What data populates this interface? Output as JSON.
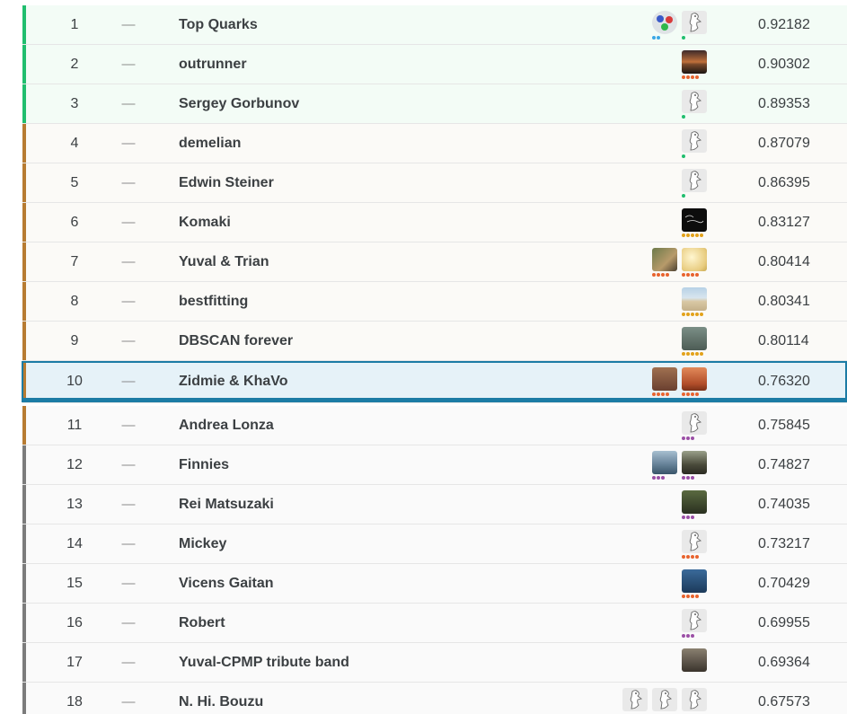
{
  "leaderboard": {
    "rows": [
      {
        "rank": "1",
        "delta": "—",
        "team": "Top Quarks",
        "score": "0.92182",
        "band": "green",
        "style": "gold-top",
        "avatars": [
          {
            "icon": "quark-logo-icon",
            "img": "quark",
            "dots": [
              "#3aa8e6",
              "#3aa8e6"
            ]
          },
          {
            "icon": "goose-avatar-icon",
            "img": "goose",
            "dots": [
              "#20be6e"
            ]
          }
        ]
      },
      {
        "rank": "2",
        "delta": "—",
        "team": "outrunner",
        "score": "0.90302",
        "band": "green",
        "style": "gold-top",
        "avatars": [
          {
            "icon": "sunset-photo-icon",
            "img": "sunset",
            "dots": [
              "#e8632e",
              "#e8632e",
              "#e8632e",
              "#e8632e"
            ]
          }
        ]
      },
      {
        "rank": "3",
        "delta": "—",
        "team": "Sergey Gorbunov",
        "score": "0.89353",
        "band": "green",
        "style": "gold-top",
        "avatars": [
          {
            "icon": "goose-avatar-icon",
            "img": "goose",
            "dots": [
              "#20be6e"
            ]
          }
        ]
      },
      {
        "rank": "4",
        "delta": "—",
        "team": "demelian",
        "score": "0.87079",
        "band": "bronze",
        "style": "medal",
        "avatars": [
          {
            "icon": "goose-avatar-icon",
            "img": "goose",
            "dots": [
              "#20be6e"
            ]
          }
        ]
      },
      {
        "rank": "5",
        "delta": "—",
        "team": "Edwin Steiner",
        "score": "0.86395",
        "band": "bronze",
        "style": "medal",
        "avatars": [
          {
            "icon": "goose-avatar-icon",
            "img": "goose",
            "dots": [
              "#20be6e"
            ]
          }
        ]
      },
      {
        "rank": "6",
        "delta": "—",
        "team": "Komaki",
        "score": "0.83127",
        "band": "bronze",
        "style": "medal",
        "avatars": [
          {
            "icon": "dark-logo-icon",
            "img": "dark",
            "dots": [
              "#e3a21a",
              "#e3a21a",
              "#e3a21a",
              "#e3a21a",
              "#e3a21a"
            ]
          }
        ]
      },
      {
        "rank": "7",
        "delta": "—",
        "team": "Yuval & Trian",
        "score": "0.80414",
        "band": "bronze",
        "style": "medal",
        "avatars": [
          {
            "icon": "animal-photo-icon",
            "img": "nature",
            "dots": [
              "#e8632e",
              "#e8632e",
              "#e8632e",
              "#e8632e"
            ]
          },
          {
            "icon": "warm-photo-icon",
            "img": "warm",
            "dots": [
              "#e8632e",
              "#e8632e",
              "#e8632e",
              "#e8632e"
            ]
          }
        ]
      },
      {
        "rank": "8",
        "delta": "—",
        "team": "bestfitting",
        "score": "0.80341",
        "band": "bronze",
        "style": "medal",
        "avatars": [
          {
            "icon": "beach-photo-icon",
            "img": "beach",
            "dots": [
              "#e3a21a",
              "#e3a21a",
              "#e3a21a",
              "#e3a21a",
              "#e3a21a"
            ]
          }
        ]
      },
      {
        "rank": "9",
        "delta": "—",
        "team": "DBSCAN forever",
        "score": "0.80114",
        "band": "bronze",
        "style": "medal",
        "avatars": [
          {
            "icon": "person-photo-icon",
            "img": "face1",
            "dots": [
              "#e3a21a",
              "#e3a21a",
              "#e3a21a",
              "#e3a21a",
              "#e3a21a"
            ]
          }
        ]
      },
      {
        "rank": "10",
        "delta": "—",
        "team": "Zidmie & KhaVo",
        "score": "0.76320",
        "band": "bronze",
        "style": "hl",
        "avatars": [
          {
            "icon": "dog-photo-icon",
            "img": "face2",
            "dots": [
              "#e8632e",
              "#e8632e",
              "#e8632e",
              "#e8632e"
            ]
          },
          {
            "icon": "desert-photo-icon",
            "img": "desert",
            "dots": [
              "#e8632e",
              "#e8632e",
              "#e8632e",
              "#e8632e"
            ]
          }
        ]
      },
      {
        "rank": "11",
        "delta": "—",
        "team": "Andrea Lonza",
        "score": "0.75845",
        "band": "bronze",
        "style": "plain",
        "avatars": [
          {
            "icon": "goose-avatar-icon",
            "img": "goose",
            "dots": [
              "#9b4fa6",
              "#9b4fa6",
              "#9b4fa6"
            ]
          }
        ]
      },
      {
        "rank": "12",
        "delta": "—",
        "team": "Finnies",
        "score": "0.74827",
        "band": "gray",
        "style": "plain",
        "avatars": [
          {
            "icon": "surf-photo-icon",
            "img": "surf",
            "dots": [
              "#9b4fa6",
              "#9b4fa6",
              "#9b4fa6"
            ]
          },
          {
            "icon": "horse-photo-icon",
            "img": "horse",
            "dots": [
              "#9b4fa6",
              "#9b4fa6",
              "#9b4fa6"
            ]
          }
        ]
      },
      {
        "rank": "13",
        "delta": "—",
        "team": "Rei Matsuzaki",
        "score": "0.74035",
        "band": "gray",
        "style": "plain",
        "avatars": [
          {
            "icon": "person-photo-icon",
            "img": "face3",
            "dots": [
              "#9b4fa6",
              "#9b4fa6",
              "#9b4fa6"
            ]
          }
        ]
      },
      {
        "rank": "14",
        "delta": "—",
        "team": "Mickey",
        "score": "0.73217",
        "band": "gray",
        "style": "plain",
        "avatars": [
          {
            "icon": "goose-avatar-icon",
            "img": "goose",
            "dots": [
              "#e8632e",
              "#e8632e",
              "#e8632e",
              "#e8632e"
            ]
          }
        ]
      },
      {
        "rank": "15",
        "delta": "—",
        "team": "Vicens Gaitan",
        "score": "0.70429",
        "band": "gray",
        "style": "plain",
        "avatars": [
          {
            "icon": "person-photo-icon",
            "img": "blue",
            "dots": [
              "#e8632e",
              "#e8632e",
              "#e8632e",
              "#e8632e"
            ]
          }
        ]
      },
      {
        "rank": "16",
        "delta": "—",
        "team": "Robert",
        "score": "0.69955",
        "band": "gray",
        "style": "plain",
        "avatars": [
          {
            "icon": "goose-avatar-icon",
            "img": "goose",
            "dots": [
              "#9b4fa6",
              "#9b4fa6",
              "#9b4fa6"
            ]
          }
        ]
      },
      {
        "rank": "17",
        "delta": "—",
        "team": "Yuval-CPMP tribute band",
        "score": "0.69364",
        "band": "gray",
        "style": "plain",
        "avatars": [
          {
            "icon": "stone-photo-icon",
            "img": "stone",
            "dots": []
          }
        ]
      },
      {
        "rank": "18",
        "delta": "—",
        "team": "N. Hi. Bouzu",
        "score": "0.67573",
        "band": "gray",
        "style": "plain",
        "avatars": [
          {
            "icon": "goose-avatar-icon",
            "img": "goose",
            "dots": []
          },
          {
            "icon": "goose-avatar-icon",
            "img": "goose",
            "dots": []
          },
          {
            "icon": "goose-avatar-icon",
            "img": "goose",
            "dots": []
          }
        ]
      }
    ]
  }
}
